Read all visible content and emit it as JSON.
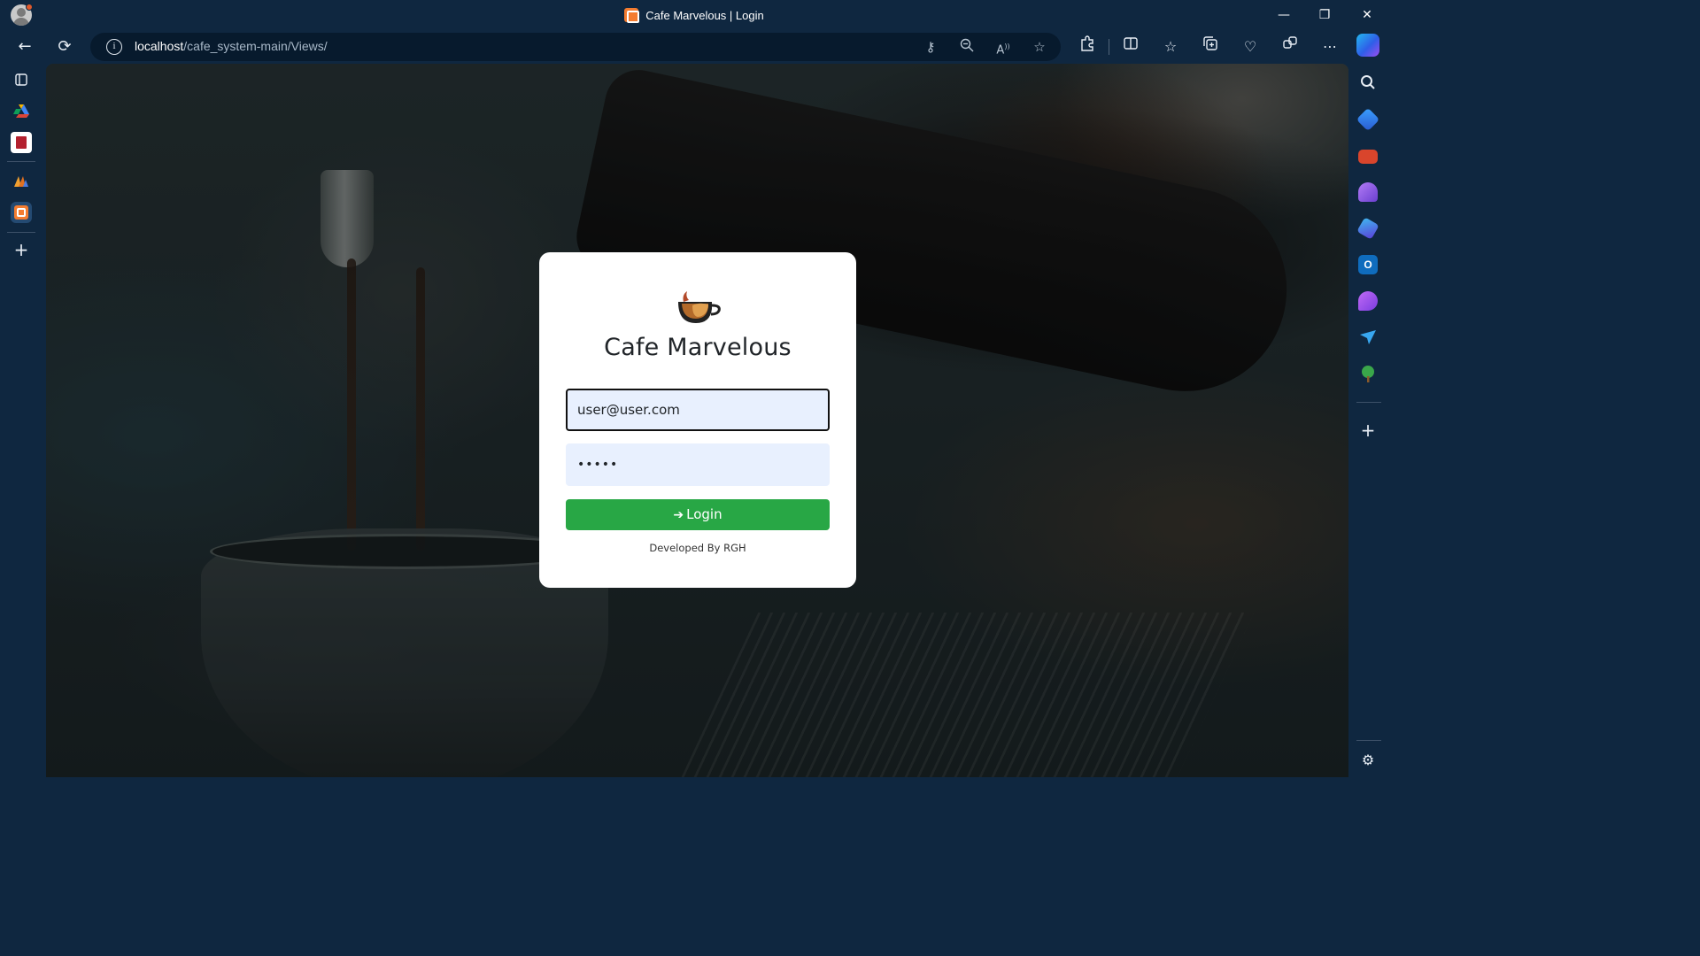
{
  "browser": {
    "tab_title": "Cafe Marvelous | Login",
    "url_host": "localhost",
    "url_path": "/cafe_system-main/Views/",
    "window_controls": {
      "minimize": "—",
      "restore": "❐",
      "close": "✕"
    },
    "nav": {
      "back": "←",
      "refresh": "⟳"
    },
    "address_icons": [
      "key-icon",
      "zoom-out-icon",
      "read-aloud-icon",
      "favorite-star-icon"
    ],
    "toolbar_icons": [
      "extensions-icon",
      "split-screen-icon",
      "favorites-icon",
      "collections-icon",
      "browser-essentials-icon",
      "workspaces-icon",
      "more-icon",
      "copilot-icon"
    ]
  },
  "left_sidebar": {
    "items": [
      "tab-actions-icon",
      "google-drive-icon",
      "tabbed-app-icon",
      "deployment-icon",
      "xampp-icon",
      "add-icon"
    ]
  },
  "right_sidebar": {
    "items": [
      "search-icon",
      "shopping-tag-icon",
      "tools-icon",
      "games-icon",
      "m365-icon",
      "outlook-icon",
      "drop-icon",
      "send-icon",
      "tree-icon",
      "add-icon",
      "settings-icon"
    ]
  },
  "login": {
    "title": "Cafe Marvelous",
    "email_value": "user@user.com",
    "password_value": "•••••",
    "login_label": "Login",
    "credit": "Developed By RGH"
  },
  "colors": {
    "chrome_bg": "#0f2740",
    "button_green": "#28a745",
    "input_bg": "#e8f0fe",
    "card_bg": "#ffffff"
  }
}
